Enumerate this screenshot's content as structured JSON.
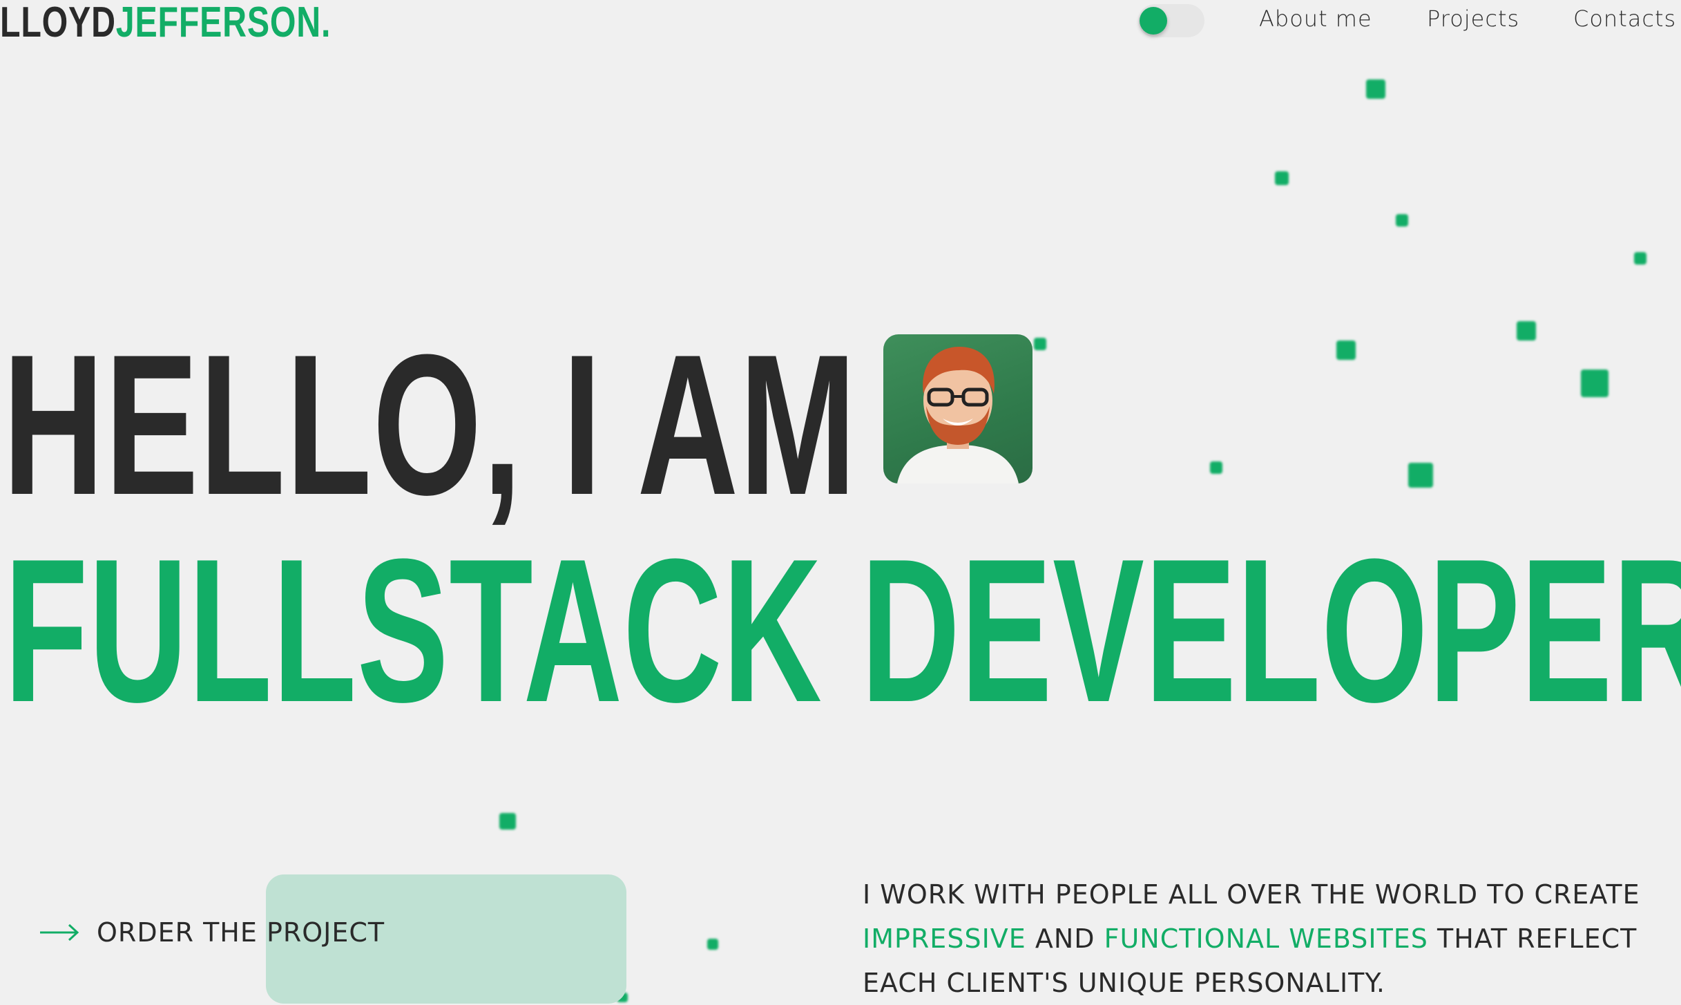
{
  "header": {
    "logo_first": "LLOYD",
    "logo_last": "JEFFERSON.",
    "theme_toggle": {
      "state": "on",
      "icon": "toggle-switch"
    },
    "nav": [
      {
        "label": "About me"
      },
      {
        "label": "Projects"
      },
      {
        "label": "Contacts"
      }
    ]
  },
  "hero": {
    "line1": "HELLO, I AM",
    "line2": "FULLSTACK DEVELOPER"
  },
  "cta": {
    "label": "ORDER THE PROJECT",
    "icon": "arrow-right-icon"
  },
  "intro": {
    "part1": "I WORK WITH PEOPLE ALL OVER THE WORLD TO CREATE ",
    "highlight1": "IMPRESSIVE",
    "part2": " AND ",
    "highlight2": "FUNCTIONAL WEBSITES",
    "part3": " THAT REFLECT EACH CLIENT'S UNIQUE PERSONALITY."
  },
  "colors": {
    "accent": "#12ad66",
    "text": "#2a2a2a",
    "background": "#f0f0f0",
    "cta_box": "#bfe1d3"
  }
}
